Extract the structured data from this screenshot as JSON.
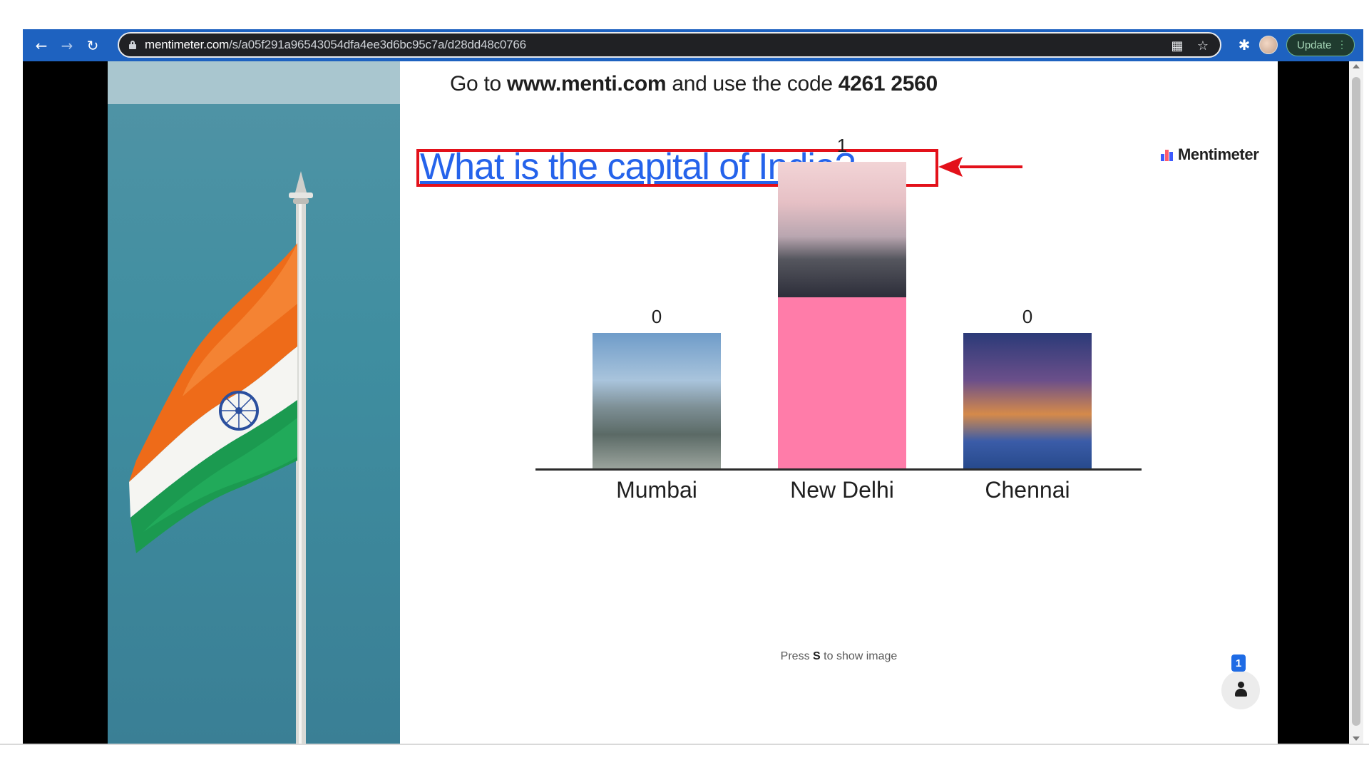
{
  "browser": {
    "url_domain": "mentimeter.com",
    "url_path": "/s/a05f291a96543054dfa4ee3d6bc95c7a/d28dd48c0766",
    "update_label": "Update",
    "icons": [
      "back-icon",
      "forward-icon",
      "reload-icon",
      "lock-icon",
      "apps-icon",
      "star-icon",
      "extensions-icon"
    ]
  },
  "slide": {
    "join_prefix": "Go to",
    "join_site": "www.menti.com",
    "join_middle": "and use the code",
    "join_code": "4261 2560",
    "question": "What is the capital of India?",
    "brand": "Mentimeter",
    "hint_prefix": "Press",
    "hint_key": "S",
    "hint_suffix": "to show image",
    "participant_count": "1",
    "accent_color": "#ff7ca9",
    "annotation_color": "#e3111a"
  },
  "chart_data": {
    "type": "bar",
    "categories": [
      "Mumbai",
      "New Delhi",
      "Chennai"
    ],
    "values": [
      0,
      1,
      0
    ],
    "title": "What is the capital of India?",
    "bar_color": "#ff7ca9"
  }
}
